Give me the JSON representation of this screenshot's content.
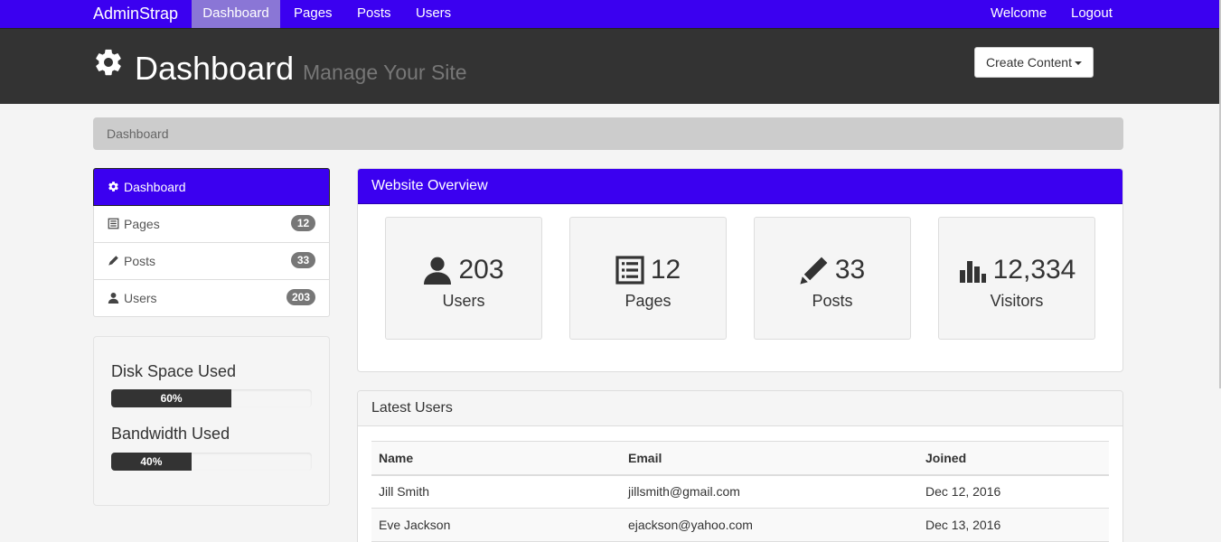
{
  "navbar": {
    "brand": "AdminStrap",
    "links": [
      {
        "label": "Dashboard",
        "active": true
      },
      {
        "label": "Pages"
      },
      {
        "label": "Posts"
      },
      {
        "label": "Users"
      }
    ],
    "right": [
      {
        "label": "Welcome"
      },
      {
        "label": "Logout"
      }
    ],
    "color": "#3b00f0"
  },
  "header": {
    "icon": "gear-icon",
    "title": "Dashboard",
    "subtitle": "Manage Your Site",
    "create_button": "Create Content"
  },
  "breadcrumb": {
    "current": "Dashboard"
  },
  "sidebar": {
    "items": [
      {
        "label": "Dashboard",
        "icon": "gear-icon",
        "active": true
      },
      {
        "label": "Pages",
        "icon": "list-icon",
        "badge": "12"
      },
      {
        "label": "Posts",
        "icon": "pencil-icon",
        "badge": "33"
      },
      {
        "label": "Users",
        "icon": "user-icon",
        "badge": "203"
      }
    ],
    "progress": [
      {
        "label": "Disk Space Used",
        "text": "60%",
        "value": 0.6
      },
      {
        "label": "Bandwidth Used",
        "text": "40%",
        "value": 0.4
      }
    ]
  },
  "overview": {
    "title": "Website Overview",
    "stats": [
      {
        "icon": "user-icon",
        "value": "203",
        "label": "Users"
      },
      {
        "icon": "list-icon",
        "value": "12",
        "label": "Pages"
      },
      {
        "icon": "pencil-icon",
        "value": "33",
        "label": "Posts"
      },
      {
        "icon": "bar-chart-icon",
        "value": "12,334",
        "label": "Visitors"
      }
    ]
  },
  "latest_users": {
    "title": "Latest Users",
    "columns": [
      "Name",
      "Email",
      "Joined"
    ],
    "rows": [
      [
        "Jill Smith",
        "jillsmith@gmail.com",
        "Dec 12, 2016"
      ],
      [
        "Eve Jackson",
        "ejackson@yahoo.com",
        "Dec 13, 2016"
      ]
    ]
  }
}
